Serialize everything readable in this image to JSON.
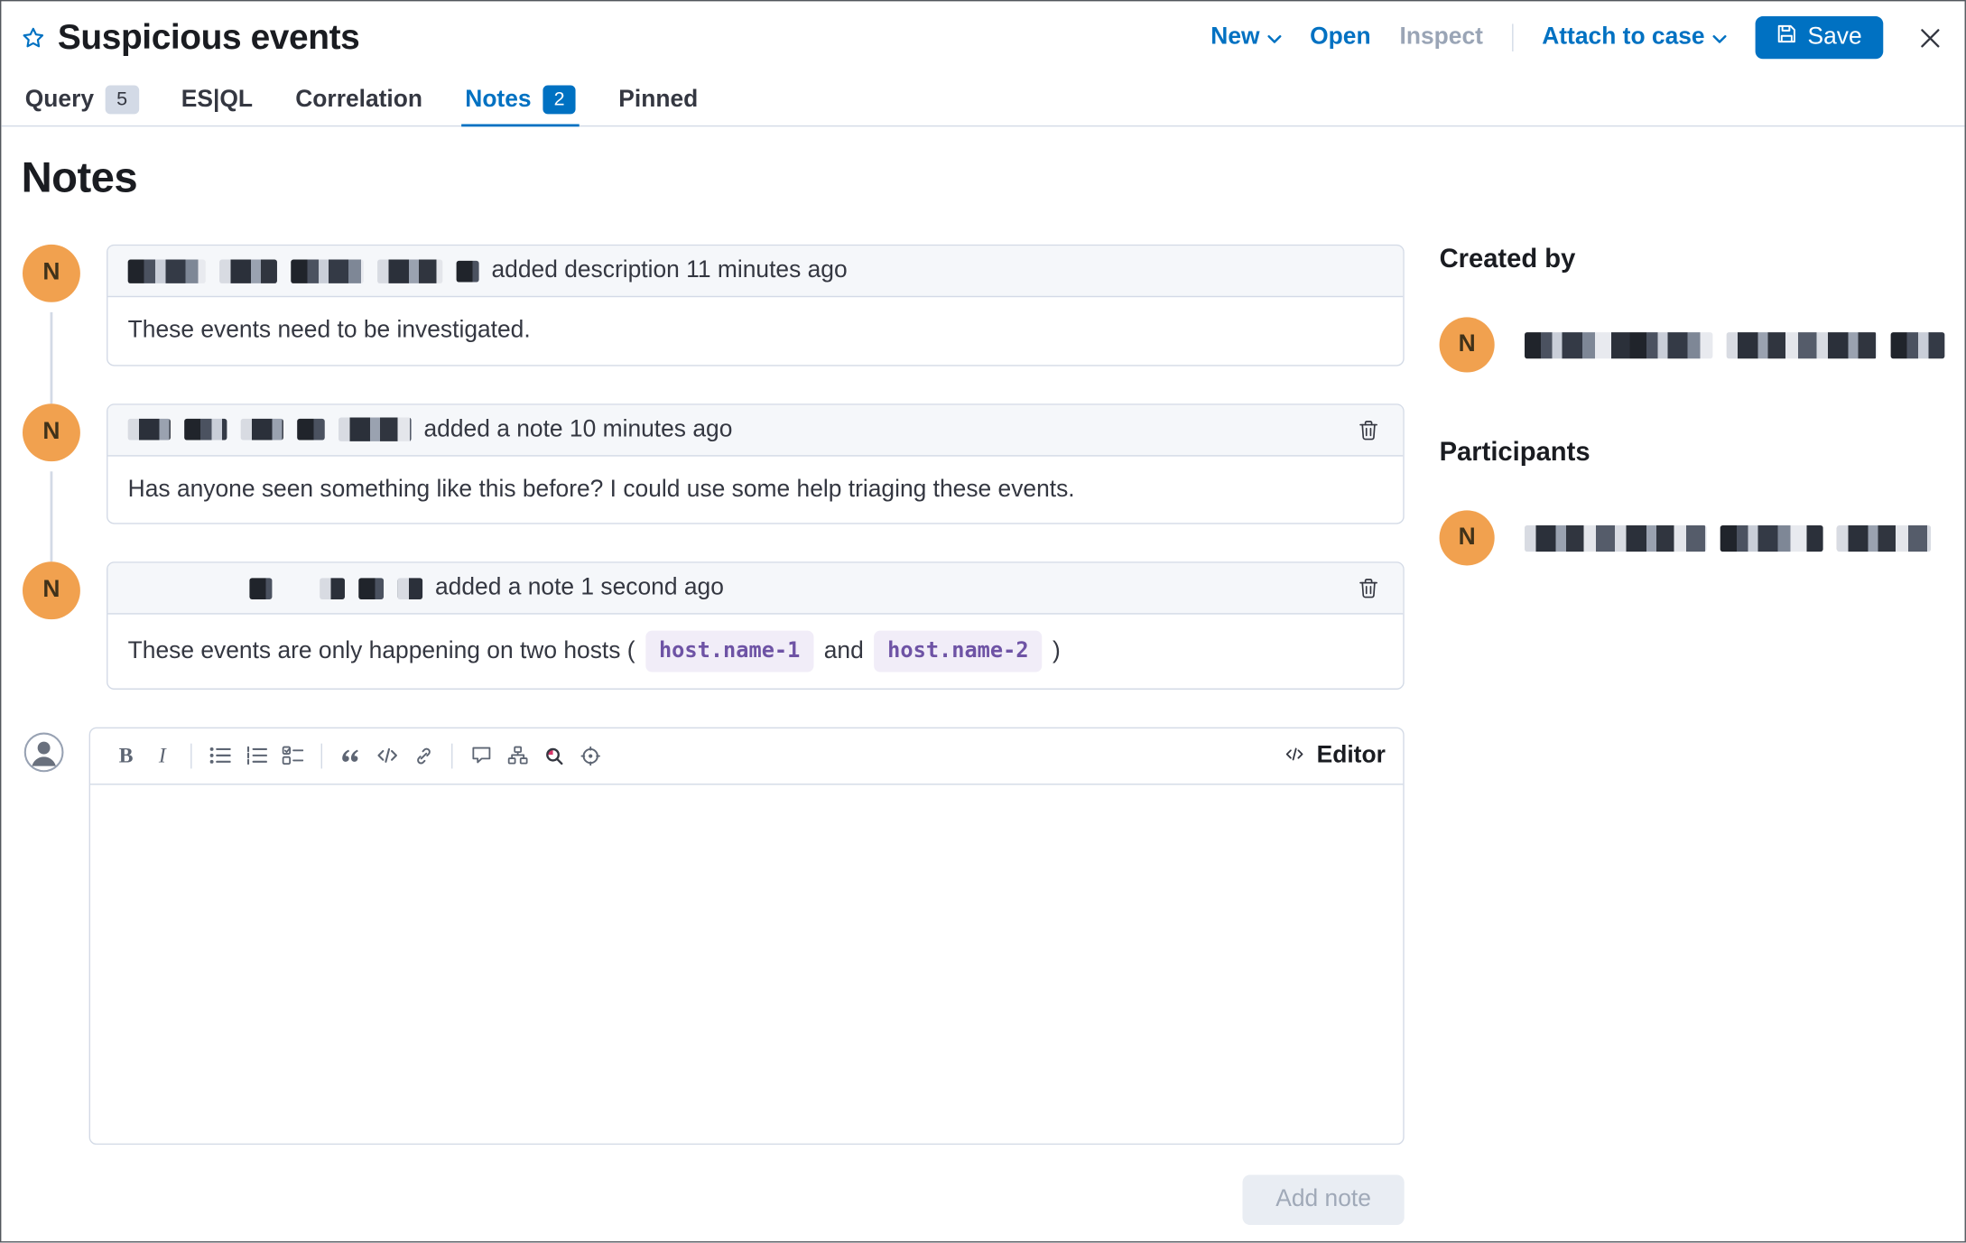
{
  "colors": {
    "accent": "#0071c2",
    "avatar_bg": "#f1a14f",
    "code_text": "#6e53a5",
    "code_bg": "#f1edf8",
    "border": "#d3dae6",
    "text": "#343741"
  },
  "header": {
    "title": "Suspicious events",
    "new_label": "New",
    "open_label": "Open",
    "inspect_label": "Inspect",
    "attach_label": "Attach to case",
    "save_label": "Save"
  },
  "tabs": [
    {
      "label": "Query",
      "badge": "5"
    },
    {
      "label": "ES|QL"
    },
    {
      "label": "Correlation"
    },
    {
      "label": "Notes",
      "badge": "2"
    },
    {
      "label": "Pinned"
    }
  ],
  "notes": {
    "heading": "Notes",
    "avatar_initial": "N",
    "items": [
      {
        "action": "added description 11 minutes ago",
        "body": "These events need to be investigated."
      },
      {
        "action": "added a note 10 minutes ago",
        "body": "Has anyone seen something like this before? I could use some help triaging these events."
      },
      {
        "action": "added a note 1 second ago",
        "body_prefix": "These events are only happening on two hosts (",
        "host_1": "host.name-1",
        "body_and": "and",
        "host_2": "host.name-2",
        "body_suffix": ")"
      }
    ]
  },
  "editor": {
    "bold_glyph": "B",
    "italic_glyph": "I",
    "mode_label": "Editor",
    "add_note_label": "Add note",
    "value": ""
  },
  "sidebar": {
    "created_by_heading": "Created by",
    "participants_heading": "Participants",
    "avatar_initial": "N"
  }
}
